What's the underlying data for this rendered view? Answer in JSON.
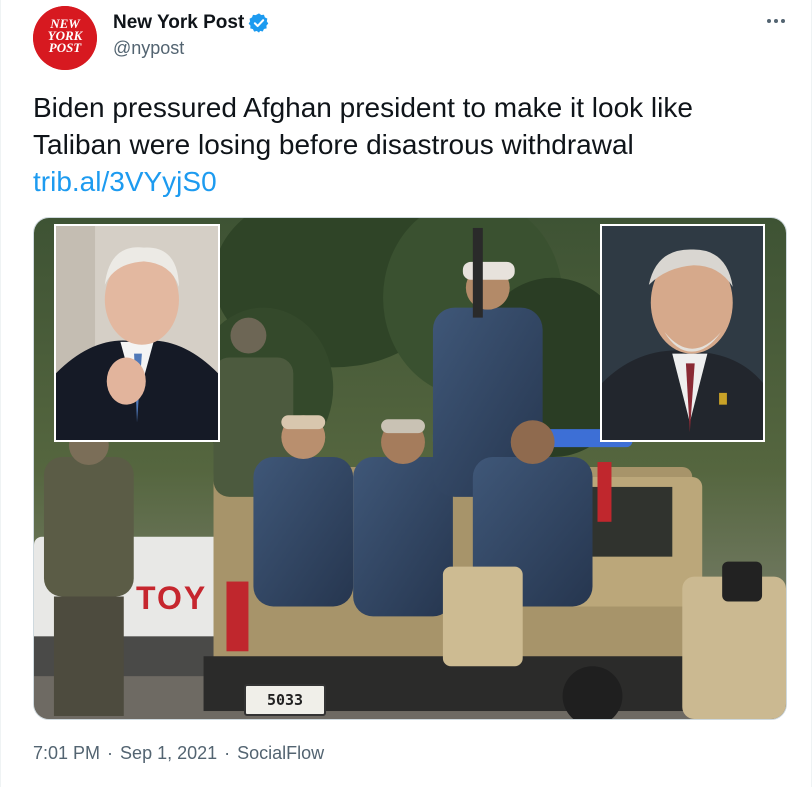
{
  "account": {
    "display_name": "New York Post",
    "handle": "@nypost",
    "avatar_lines": [
      "NEW",
      "YORK",
      "POST"
    ],
    "verified": true
  },
  "tweet": {
    "text_lines": [
      "Biden pressured Afghan president to make it look like",
      "Taliban were losing before disastrous withdrawal"
    ],
    "link": "trib.al/3VYyjS0"
  },
  "media": {
    "truck_text": "TOY",
    "plate_text": "5033"
  },
  "meta": {
    "time": "7:01 PM",
    "separator": "·",
    "date": "Sep 1, 2021",
    "source": "SocialFlow"
  },
  "colors": {
    "brand_red": "#d71920",
    "link_blue": "#1d9bf0",
    "secondary_text": "#536471",
    "verified_blue": "#1d9bf0"
  },
  "icons": {
    "verified": "verified-badge-icon",
    "more": "more-options-icon"
  }
}
